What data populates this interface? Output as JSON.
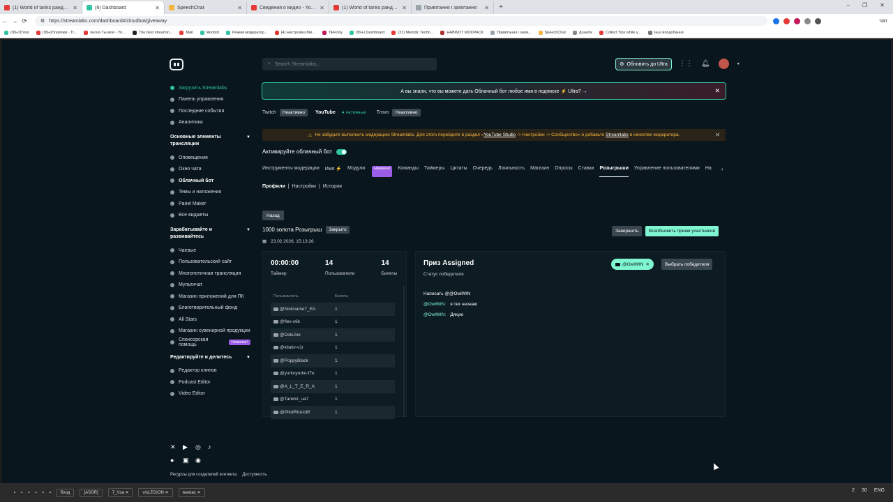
{
  "browser": {
    "tabs": [
      {
        "label": "(1) World of tanks рандом - YouTube",
        "color": "#e53935"
      },
      {
        "label": "(6) Dashboard",
        "color": "#31c3a2",
        "active": true
      },
      {
        "label": "SpeechChat",
        "color": "#f4b740"
      },
      {
        "label": "Сведения о видео - YouTube Studio",
        "color": "#e53935"
      },
      {
        "label": "(1) World of tanks рандом - YouTube",
        "color": "#e53935"
      },
      {
        "label": "Привітання і запитання",
        "color": "#9aa3a9"
      }
    ],
    "new_tab": "+",
    "window_controls": [
      "–",
      "❐",
      "✕"
    ],
    "url": "https://streamlabs.com/dashboard#/cloudbot/giveaway",
    "bookmarks": [
      "(99+)Trovo",
      "(99+)Платежи - Tr...",
      "песня Ты моё - Yo...",
      "The best streamin...",
      "Mail",
      "Moobot",
      "Режим модератор...",
      "(4) Настройка Ми...",
      "TikFinity",
      "(99+) Dashboard",
      "(31) Melodic Techn...",
      "НАВWOT MODPACK",
      "Привітання і запи...",
      "SpeechChat",
      "Донатік",
      "Collect Tips while y...",
      "Інші вподобання"
    ],
    "chat_label": "Чат"
  },
  "sidebar": {
    "top_items": [
      {
        "label": "Загрузить Streamlabs",
        "style": "green"
      },
      {
        "label": "Панель управления"
      },
      {
        "label": "Последние события"
      },
      {
        "label": "Аналитика"
      }
    ],
    "section1": "Основные элементы трансляции",
    "section1_items": [
      {
        "label": "Оповещения"
      },
      {
        "label": "Окно чата"
      },
      {
        "label": "Облачный бот",
        "style": "bold"
      },
      {
        "label": "Темы и наложения"
      },
      {
        "label": "Panel Maker"
      },
      {
        "label": "Все виджеты"
      }
    ],
    "section2": "Зарабатывайте и развивайтесь",
    "section2_items": [
      {
        "label": "Чаевые"
      },
      {
        "label": "Пользовательский сайт"
      },
      {
        "label": "Многопоточная трансляция"
      },
      {
        "label": "Мультичат"
      },
      {
        "label": "Магазин приложений для ПК"
      },
      {
        "label": "Благотворительный фонд"
      },
      {
        "label": "All Stars"
      },
      {
        "label": "Магазин сувенирной продукции"
      },
      {
        "label": "Спонсорская помощь",
        "badge": "Новинка!"
      }
    ],
    "section3": "Редактируйте и делитесь",
    "section3_items": [
      {
        "label": "Редактор клипов"
      },
      {
        "label": "Podcast Editor"
      },
      {
        "label": "Video Editor"
      }
    ],
    "footer_links": [
      "Ресурсы для создателей контента",
      "Доступность"
    ]
  },
  "header": {
    "search_placeholder": "Search Streamlabs...",
    "ultra_button": "Обновить до Ultra"
  },
  "banner": "А вы знали, что вы можете дать Облачный бот любое имя в подписке ⚡ Ultra? →",
  "platforms": [
    {
      "name": "Twitch",
      "status": "Неактивно"
    },
    {
      "name": "YouTube",
      "status": "Активные",
      "active": true
    },
    {
      "name": "Trovo",
      "status": "Неактивно"
    }
  ],
  "warning": {
    "text1": "Не забудьте выполнить модерацию Streamlabs. Для этого перейдите в раздел «",
    "link1": "YouTube Studio",
    "text2": " -> Настройки -> Сообщество» и добавьте ",
    "link2": "Streamlabs",
    "text3": " в качестве модератора."
  },
  "cloudbot_toggle_label": "Активируйте облачный бот",
  "nav_tabs": [
    "Инструменты модерации",
    "Имя ⚡",
    "Модули",
    "Команды",
    "Таймеры",
    "Цитаты",
    "Очередь",
    "Лояльность",
    "Магазин",
    "Опросы",
    "Ставки",
    "Розыгрыши",
    "Управление пользователями",
    "На"
  ],
  "nav_new_badge": "Новинка!",
  "sub_tabs": [
    "Профили",
    "Настройки",
    "История"
  ],
  "giveaway": {
    "back_button": "Назад",
    "title": "1000 золота Розыгрыш",
    "status": "Закрыто",
    "date": "23.02.2026, 15:13:26",
    "end_button": "Завершить",
    "resume_button": "Возобновить прием участников",
    "stats": [
      {
        "value": "00:00:00",
        "label": "Таймер"
      },
      {
        "value": "14",
        "label": "Пользователи"
      },
      {
        "value": "14",
        "label": "Билеты"
      }
    ],
    "table_headers": [
      "Пользователь",
      "Билеты"
    ],
    "entries": [
      {
        "user": "@Nickname7_EA",
        "tickets": "1"
      },
      {
        "user": "@flex-c6k",
        "tickets": "1"
      },
      {
        "user": "@DokiJok",
        "tickets": "1"
      },
      {
        "user": "@kilativ-v1r",
        "tickets": "1"
      },
      {
        "user": "@PoppyBlack",
        "tickets": "1"
      },
      {
        "user": "@yurkoyurko-f7e",
        "tickets": "1"
      },
      {
        "user": "@A_L_T_E_R_A",
        "tickets": "1"
      },
      {
        "user": "@Tankist_ua7",
        "tickets": "1"
      },
      {
        "user": "@PilotPilot-b8f",
        "tickets": "1"
      }
    ],
    "prize_title": "Приз Assigned",
    "winner_status": "Статус победителя",
    "winner": "@OwlWIN",
    "pick_winner_button": "Выбрать победителя",
    "chat": [
      {
        "name": "",
        "text": "Написать @@OwlWIN"
      },
      {
        "name": "@OwlWIN:",
        "text": "я тех незнаю"
      },
      {
        "name": "@OwlWIN:",
        "text": "Дякую"
      }
    ]
  },
  "taskbar": {
    "items": [
      "Вход",
      "[ASGR]",
      "7_Vsa ✕",
      "v/sLEGION ✕",
      "tevetac ✕"
    ],
    "tray": [
      "2",
      "30",
      "ENG"
    ]
  }
}
